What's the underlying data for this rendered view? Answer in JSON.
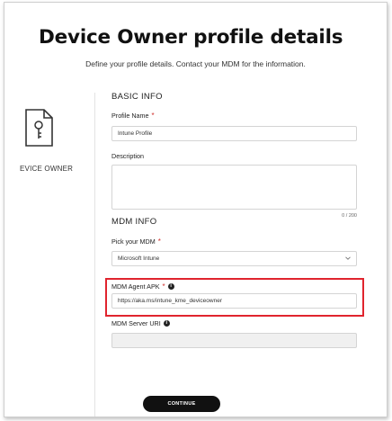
{
  "header": {
    "title": "Device Owner profile details",
    "subtitle": "Define your profile details. Contact your MDM for the information."
  },
  "sidebar": {
    "icon": "certificate-key-icon",
    "label": "EVICE OWNER"
  },
  "basic_info": {
    "heading": "BASIC INFO",
    "profile_name": {
      "label": "Profile Name",
      "required_marker": "*",
      "value": "Intune Profile"
    },
    "description": {
      "label": "Description",
      "value": "",
      "char_count": "0 / 200"
    }
  },
  "mdm_info": {
    "heading": "MDM INFO",
    "pick_mdm": {
      "label": "Pick your MDM",
      "required_marker": "*",
      "selected": "Microsoft Intune"
    },
    "agent_apk": {
      "label": "MDM Agent APK",
      "required_marker": "*",
      "value": "https://aka.ms/intune_kme_deviceowner",
      "highlight_color": "#e0242e"
    },
    "server_uri": {
      "label": "MDM Server URI",
      "value": ""
    }
  },
  "footer": {
    "continue_label": "CONTINUE"
  }
}
